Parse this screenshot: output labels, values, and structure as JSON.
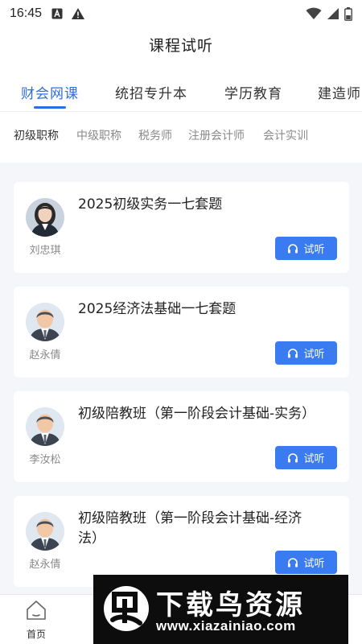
{
  "status_bar": {
    "time": "16:45",
    "left_icons": [
      "a-box-icon",
      "warning-icon"
    ],
    "right_icons": [
      "wifi-icon",
      "signal-icon",
      "battery-icon"
    ]
  },
  "page_title": "课程试听",
  "top_tabs": [
    {
      "label": "财会网课",
      "active": true
    },
    {
      "label": "统招专升本",
      "active": false
    },
    {
      "label": "学历教育",
      "active": false
    },
    {
      "label": "建造师",
      "active": false
    }
  ],
  "sub_tabs": [
    {
      "label": "初级职称",
      "active": true
    },
    {
      "label": "中级职称",
      "active": false
    },
    {
      "label": "税务师",
      "active": false
    },
    {
      "label": "注册会计师",
      "active": false
    },
    {
      "label": "会计实训",
      "active": false
    }
  ],
  "courses": [
    {
      "teacher": "刘忠琪",
      "title": "2025初级实务一七套题",
      "button": "试听",
      "avatar": "female-teacher-photo"
    },
    {
      "teacher": "赵永倩",
      "title": "2025经济法基础一七套题",
      "button": "试听",
      "avatar": "default-avatar-icon"
    },
    {
      "teacher": "李汝松",
      "title": "初级陪教班（第一阶段会计基础-实务）",
      "button": "试听",
      "avatar": "default-avatar-icon"
    },
    {
      "teacher": "赵永倩",
      "title": "初级陪教班（第一阶段会计基础-经济法）",
      "button": "试听",
      "avatar": "default-avatar-icon"
    }
  ],
  "bottom_nav": {
    "home_label": "首页"
  },
  "watermark": {
    "title": "下载鸟资源",
    "url": "www.xiazainiao.com"
  },
  "colors": {
    "accent": "#2e6fe0",
    "button": "#3a7bf2",
    "content_bg": "#f4f6fa"
  }
}
